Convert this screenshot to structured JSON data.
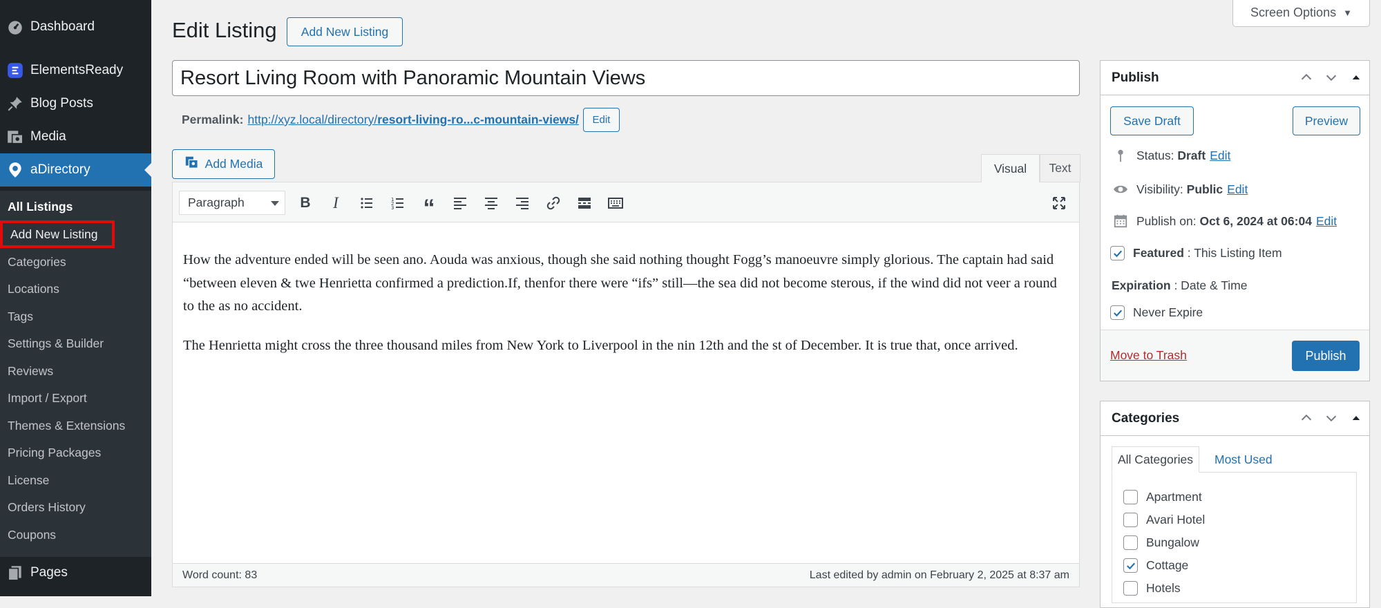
{
  "sidebar": {
    "top_items": [
      {
        "label": "Dashboard",
        "icon": "dashboard-icon"
      },
      {
        "label": "ElementsReady",
        "icon": "elementsready-icon"
      },
      {
        "label": "Blog Posts",
        "icon": "pin-icon"
      },
      {
        "label": "Media",
        "icon": "media-icon"
      },
      {
        "label": "aDirectory",
        "icon": "location-pin-icon"
      }
    ],
    "submenu": [
      "All Listings",
      "Add New Listing",
      "Categories",
      "Locations",
      "Tags",
      "Settings & Builder",
      "Reviews",
      "Import / Export",
      "Themes & Extensions",
      "Pricing Packages",
      "License",
      "Orders History",
      "Coupons"
    ],
    "bottom_item": {
      "label": "Pages",
      "icon": "pages-icon"
    },
    "colors": {
      "bg": "#1d2327",
      "active": "#2271b1",
      "highlight_box": "#e20b0b"
    }
  },
  "header": {
    "title": "Edit Listing",
    "add_new_label": "Add New Listing",
    "screen_options_label": "Screen Options"
  },
  "post": {
    "title": "Resort Living Room with Panoramic Mountain Views",
    "permalink_label": "Permalink:",
    "permalink_base": "http://xyz.local/directory/",
    "permalink_slug": "resort-living-ro...c-mountain-views/",
    "permalink_edit": "Edit"
  },
  "editor": {
    "add_media_label": "Add Media",
    "tab_visual": "Visual",
    "tab_text": "Text",
    "format_value": "Paragraph",
    "toolbar_icons": [
      "bold-icon",
      "italic-icon",
      "bullet-list-icon",
      "numbered-list-icon",
      "blockquote-icon",
      "align-left-icon",
      "align-center-icon",
      "align-right-icon",
      "link-icon",
      "read-more-icon",
      "toolbar-toggle-icon",
      "fullscreen-icon"
    ],
    "paragraphs": [
      "How the adventure ended will be seen ano. Aouda was anxious, though she said nothing thought Fogg’s manoeuvre simply glorious. The captain had said “between eleven & twe Henrietta confirmed a prediction.If, thenfor there were “ifs” still—the sea did not become sterous, if the wind did not veer a round to the as no accident.",
      "The Henrietta might cross the three thousand miles from New York to Liverpool in the nin 12th and the st of December. It is true that, once arrived."
    ],
    "word_count": "Word count: 83",
    "last_edited": "Last edited by admin on February 2, 2025 at 8:37 am"
  },
  "publish": {
    "title": "Publish",
    "save_draft": "Save Draft",
    "preview": "Preview",
    "status_label": "Status:",
    "status_value": "Draft",
    "visibility_label": "Visibility:",
    "visibility_value": "Public",
    "publish_on_label": "Publish on:",
    "publish_on_value": "Oct 6, 2024 at 06:04",
    "edit": "Edit",
    "featured_label": "Featured",
    "featured_rest": ": This Listing Item",
    "featured_checked": true,
    "expiration_label": "Expiration",
    "expiration_rest": ": Date & Time",
    "never_expire": "Never Expire",
    "never_expire_checked": true,
    "move_to_trash": "Move to Trash",
    "publish_button": "Publish"
  },
  "categories": {
    "title": "Categories",
    "tab_all": "All Categories",
    "tab_most_used": "Most Used",
    "items": [
      {
        "label": "Apartment",
        "checked": false
      },
      {
        "label": "Avari Hotel",
        "checked": false
      },
      {
        "label": "Bungalow",
        "checked": false
      },
      {
        "label": "Cottage",
        "checked": true
      },
      {
        "label": "Hotels",
        "checked": false
      }
    ]
  }
}
